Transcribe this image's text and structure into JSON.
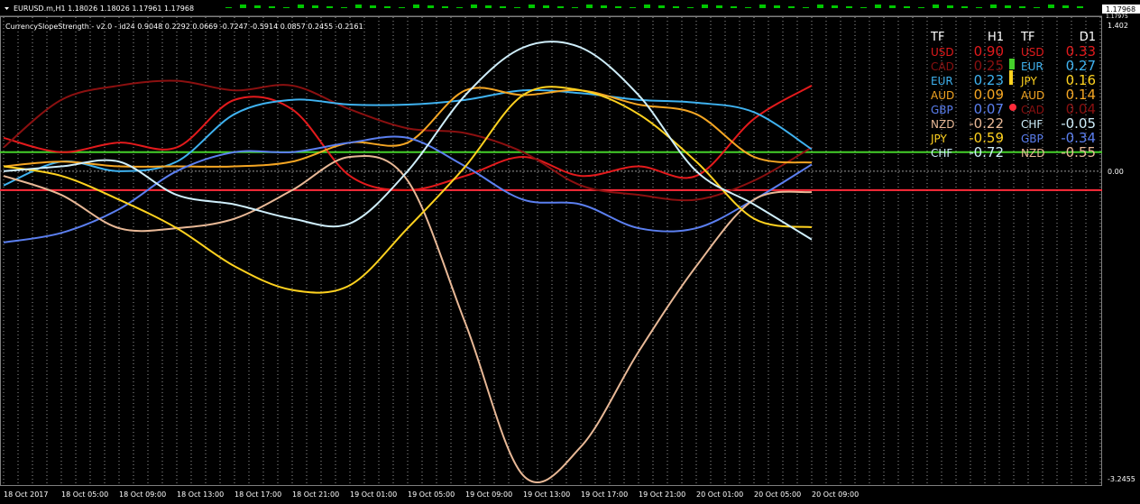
{
  "chart_header": {
    "symbol_line": "EURUSD.m,H1  1.18026 1.18026 1.17961 1.17968",
    "indicator_line": "CurrencySlopeStrength - v2.0 - id24 0.9048 0.2292 0.0669 -0.7247 -0.5914 0.0857 0.2455 -0.2161"
  },
  "price_scale": {
    "top_price": "1.17968",
    "top_price_small": "1.17975",
    "indicator_max": "1.402",
    "indicator_zero": "0.00",
    "indicator_min": "-3.2455"
  },
  "colors": {
    "USD": "#e31a1c",
    "CAD": "#8b1010",
    "EUR": "#3fb2f0",
    "AUD": "#f5a623",
    "GBP": "#5b7ff0",
    "NZD": "#e8b896",
    "JPY": "#ffd21f",
    "CHF": "#cfeefb",
    "upper_level": "#44d02a",
    "lower_level": "#ff2b3a",
    "grid": "#9a9a9a",
    "zero_line": "#9a9a9a"
  },
  "strength_table": {
    "h1_header_tf": "TF",
    "h1_header": "H1",
    "d1_header_tf": "TF",
    "d1_header": "D1",
    "h1_rows": [
      {
        "cur": "USD",
        "val": "0.90",
        "color": "#e31a1c"
      },
      {
        "cur": "CAD",
        "val": "0.25",
        "color": "#8b1010"
      },
      {
        "cur": "EUR",
        "val": "0.23",
        "color": "#3fb2f0"
      },
      {
        "cur": "AUD",
        "val": "0.09",
        "color": "#f5a623"
      },
      {
        "cur": "GBP",
        "val": "0.07",
        "color": "#5b7ff0"
      },
      {
        "cur": "NZD",
        "val": "-0.22",
        "color": "#e8b896"
      },
      {
        "cur": "JPY",
        "val": "-0.59",
        "color": "#ffd21f"
      },
      {
        "cur": "CHF",
        "val": "-0.72",
        "color": "#cfeefb"
      }
    ],
    "d1_rows": [
      {
        "cur": "USD",
        "val": "0.33",
        "color": "#e31a1c"
      },
      {
        "cur": "EUR",
        "val": "0.27",
        "color": "#3fb2f0"
      },
      {
        "cur": "JPY",
        "val": "0.16",
        "color": "#ffd21f"
      },
      {
        "cur": "AUD",
        "val": "0.14",
        "color": "#f5a623"
      },
      {
        "cur": "CAD",
        "val": "0.04",
        "color": "#8b1010"
      },
      {
        "cur": "CHF",
        "val": "-0.05",
        "color": "#cfeefb"
      },
      {
        "cur": "GBP",
        "val": "-0.34",
        "color": "#5b7ff0"
      },
      {
        "cur": "NZD",
        "val": "-0.55",
        "color": "#e8b896"
      }
    ]
  },
  "chart_data": {
    "type": "line",
    "x": [
      "18 Oct 2017",
      "18 Oct 05:00",
      "18 Oct 09:00",
      "18 Oct 13:00",
      "18 Oct 17:00",
      "18 Oct 21:00",
      "19 Oct 01:00",
      "19 Oct 05:00",
      "19 Oct 09:00",
      "19 Oct 13:00",
      "19 Oct 17:00",
      "19 Oct 21:00",
      "20 Oct 01:00",
      "20 Oct 05:00",
      "20 Oct 09:00"
    ],
    "ylim": [
      -3.2455,
      1.402
    ],
    "levels": [
      0.2,
      -0.2
    ],
    "series": [
      {
        "name": "USD",
        "values": [
          0.35,
          0.2,
          0.3,
          0.25,
          0.75,
          0.65,
          -0.05,
          -0.2,
          -0.05,
          0.15,
          -0.05,
          0.05,
          -0.05,
          0.55,
          0.9
        ]
      },
      {
        "name": "CAD",
        "values": [
          0.25,
          0.75,
          0.9,
          0.95,
          0.85,
          0.9,
          0.65,
          0.45,
          0.4,
          0.2,
          -0.15,
          -0.25,
          -0.3,
          -0.1,
          0.25
        ]
      },
      {
        "name": "EUR",
        "values": [
          -0.15,
          0.1,
          0.0,
          0.1,
          0.6,
          0.75,
          0.7,
          0.7,
          0.75,
          0.85,
          0.82,
          0.75,
          0.72,
          0.62,
          0.23
        ]
      },
      {
        "name": "AUD",
        "values": [
          0.05,
          0.1,
          0.05,
          0.05,
          0.05,
          0.1,
          0.3,
          0.3,
          0.85,
          0.8,
          0.85,
          0.7,
          0.6,
          0.15,
          0.09
        ]
      },
      {
        "name": "GBP",
        "values": [
          -0.75,
          -0.65,
          -0.4,
          0.0,
          0.2,
          0.2,
          0.3,
          0.35,
          0.05,
          -0.3,
          -0.35,
          -0.6,
          -0.6,
          -0.3,
          0.07
        ]
      },
      {
        "name": "NZD",
        "values": [
          -0.05,
          -0.25,
          -0.6,
          -0.6,
          -0.5,
          -0.2,
          0.15,
          -0.1,
          -1.6,
          -3.2,
          -2.9,
          -1.9,
          -1.0,
          -0.3,
          -0.22
        ]
      },
      {
        "name": "JPY",
        "values": [
          0.05,
          -0.05,
          -0.3,
          -0.6,
          -1.0,
          -1.25,
          -1.2,
          -0.6,
          0.05,
          0.8,
          0.85,
          0.6,
          0.1,
          -0.5,
          -0.59
        ]
      },
      {
        "name": "CHF",
        "values": [
          0.0,
          0.05,
          0.1,
          -0.25,
          -0.35,
          -0.5,
          -0.55,
          0.0,
          0.8,
          1.3,
          1.3,
          0.8,
          0.0,
          -0.35,
          -0.72
        ]
      }
    ]
  }
}
